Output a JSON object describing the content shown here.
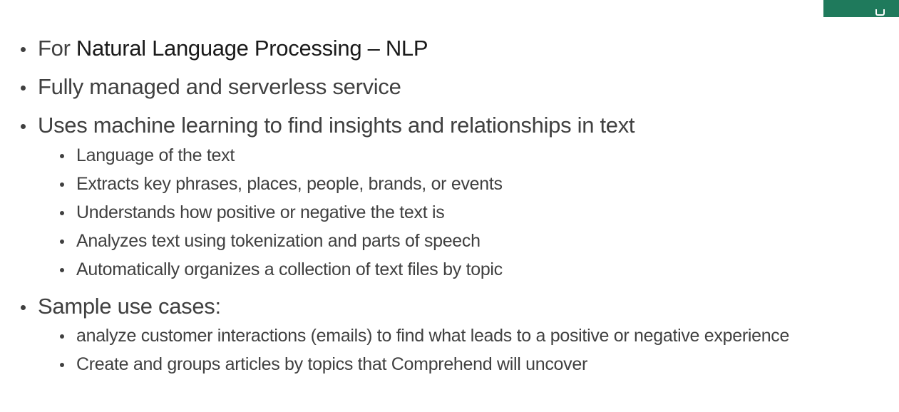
{
  "slide": {
    "bullets": [
      {
        "prefix": "For ",
        "emphasis": "Natural Language Processing – NLP"
      },
      {
        "text": "Fully managed and serverless service"
      },
      {
        "text": "Uses machine learning to find insights and relationships in text"
      },
      {
        "text": "Language of the text"
      },
      {
        "text": "Extracts key phrases, places, people, brands, or events"
      },
      {
        "text": "Understands how positive or negative the text is"
      },
      {
        "text": "Analyzes text using tokenization and parts of speech"
      },
      {
        "text": "Automatically organizes a collection of text files by topic"
      },
      {
        "text": "Sample use cases:"
      },
      {
        "text": "analyze customer interactions (emails) to find what leads to a positive or negative experience"
      },
      {
        "text": "Create and groups articles by topics that Comprehend will uncover"
      }
    ]
  },
  "colors": {
    "text": "#404040",
    "emphasis": "#1a1a1a",
    "accent": "#1f7a5c"
  },
  "icons": {
    "corner": "corner-tab-icon"
  }
}
